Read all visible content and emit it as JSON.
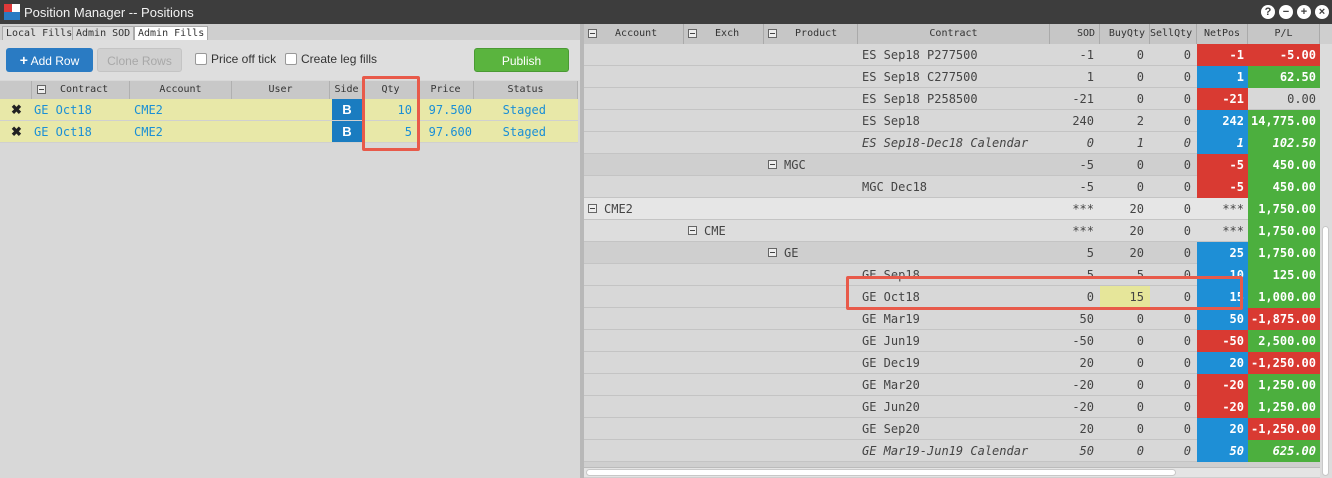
{
  "window": {
    "title": "Position Manager -- Positions",
    "controls": [
      "?",
      "−",
      "+",
      "×"
    ]
  },
  "left": {
    "tabs": [
      "Local Fills",
      "Admin SOD",
      "Admin Fills"
    ],
    "active_tab": "Admin Fills",
    "toolbar": {
      "add_row": "Add Row",
      "clone_rows": "Clone Rows",
      "price_off_tick": "Price off tick",
      "create_leg_fills": "Create leg fills",
      "publish": "Publish"
    },
    "columns": [
      "Contract",
      "Account",
      "User",
      "Side",
      "Qty",
      "Price",
      "Status"
    ],
    "rows": [
      {
        "contract": "GE Oct18",
        "account": "CME2",
        "user": "",
        "side": "B",
        "qty": "10",
        "price": "97.500",
        "status": "Staged"
      },
      {
        "contract": "GE Oct18",
        "account": "CME2",
        "user": "",
        "side": "B",
        "qty": "5",
        "price": "97.600",
        "status": "Staged"
      }
    ]
  },
  "right": {
    "columns": [
      "Account",
      "Exch",
      "Product",
      "Contract",
      "SOD",
      "BuyQty",
      "SellQty",
      "NetPos",
      "P/L"
    ],
    "rows": [
      {
        "label": "ES Sep18 P277500",
        "indent": "contract",
        "sod": "-1",
        "buy": "0",
        "sell": "0",
        "netpos": "-1",
        "np_color": "red",
        "pl": "-5.00",
        "pl_color": "red",
        "italic": false,
        "bg": "#d8d8d8"
      },
      {
        "label": "ES Sep18 C277500",
        "indent": "contract",
        "sod": "1",
        "buy": "0",
        "sell": "0",
        "netpos": "1",
        "np_color": "blue",
        "pl": "62.50",
        "pl_color": "green",
        "italic": false,
        "bg": "#d8d8d8"
      },
      {
        "label": "ES Sep18 P258500",
        "indent": "contract",
        "sod": "-21",
        "buy": "0",
        "sell": "0",
        "netpos": "-21",
        "np_color": "red",
        "pl": "0.00",
        "pl_color": "none",
        "italic": false,
        "bg": "#d8d8d8"
      },
      {
        "label": "ES Sep18",
        "indent": "contract",
        "sod": "240",
        "buy": "2",
        "sell": "0",
        "netpos": "242",
        "np_color": "blue",
        "pl": "14,775.00",
        "pl_color": "green",
        "italic": false,
        "bg": "#d8d8d8"
      },
      {
        "label": "ES Sep18-Dec18 Calendar",
        "indent": "contract",
        "sod": "0",
        "buy": "1",
        "sell": "0",
        "netpos": "1",
        "np_color": "blue",
        "pl": "102.50",
        "pl_color": "green",
        "italic": true,
        "bg": "#d8d8d8"
      },
      {
        "label": "MGC",
        "indent": "product",
        "sod": "-5",
        "buy": "0",
        "sell": "0",
        "netpos": "-5",
        "np_color": "red",
        "pl": "450.00",
        "pl_color": "green",
        "italic": false,
        "bg": "#cfcfcf"
      },
      {
        "label": "MGC Dec18",
        "indent": "contract",
        "sod": "-5",
        "buy": "0",
        "sell": "0",
        "netpos": "-5",
        "np_color": "red",
        "pl": "450.00",
        "pl_color": "green",
        "italic": false,
        "bg": "#d8d8d8"
      },
      {
        "label": "CME2",
        "indent": "account",
        "sod": "***",
        "buy": "20",
        "sell": "0",
        "netpos": "***",
        "np_color": "none",
        "pl": "1,750.00",
        "pl_color": "green",
        "italic": false,
        "bg": "#e6e6e6"
      },
      {
        "label": "CME",
        "indent": "exch",
        "sod": "***",
        "buy": "20",
        "sell": "0",
        "netpos": "***",
        "np_color": "none",
        "pl": "1,750.00",
        "pl_color": "green",
        "italic": false,
        "bg": "#dddddd"
      },
      {
        "label": "GE",
        "indent": "product",
        "sod": "5",
        "buy": "20",
        "sell": "0",
        "netpos": "25",
        "np_color": "blue",
        "pl": "1,750.00",
        "pl_color": "green",
        "italic": false,
        "bg": "#cfcfcf"
      },
      {
        "label": "GE Sep18",
        "indent": "contract",
        "sod": "5",
        "buy": "5",
        "sell": "0",
        "netpos": "10",
        "np_color": "blue",
        "pl": "125.00",
        "pl_color": "green",
        "italic": false,
        "bg": "#d8d8d8"
      },
      {
        "label": "GE Oct18",
        "indent": "contract",
        "sod": "0",
        "buy": "15",
        "sell": "0",
        "netpos": "15",
        "np_color": "blue",
        "pl": "1,000.00",
        "pl_color": "green",
        "italic": false,
        "bg": "#d8d8d8",
        "buy_highlight": true
      },
      {
        "label": "GE Mar19",
        "indent": "contract",
        "sod": "50",
        "buy": "0",
        "sell": "0",
        "netpos": "50",
        "np_color": "blue",
        "pl": "-1,875.00",
        "pl_color": "red",
        "italic": false,
        "bg": "#d8d8d8"
      },
      {
        "label": "GE Jun19",
        "indent": "contract",
        "sod": "-50",
        "buy": "0",
        "sell": "0",
        "netpos": "-50",
        "np_color": "red",
        "pl": "2,500.00",
        "pl_color": "green",
        "italic": false,
        "bg": "#d8d8d8"
      },
      {
        "label": "GE Dec19",
        "indent": "contract",
        "sod": "20",
        "buy": "0",
        "sell": "0",
        "netpos": "20",
        "np_color": "blue",
        "pl": "-1,250.00",
        "pl_color": "red",
        "italic": false,
        "bg": "#d8d8d8"
      },
      {
        "label": "GE Mar20",
        "indent": "contract",
        "sod": "-20",
        "buy": "0",
        "sell": "0",
        "netpos": "-20",
        "np_color": "red",
        "pl": "1,250.00",
        "pl_color": "green",
        "italic": false,
        "bg": "#d8d8d8"
      },
      {
        "label": "GE Jun20",
        "indent": "contract",
        "sod": "-20",
        "buy": "0",
        "sell": "0",
        "netpos": "-20",
        "np_color": "red",
        "pl": "1,250.00",
        "pl_color": "green",
        "italic": false,
        "bg": "#d8d8d8"
      },
      {
        "label": "GE Sep20",
        "indent": "contract",
        "sod": "20",
        "buy": "0",
        "sell": "0",
        "netpos": "20",
        "np_color": "blue",
        "pl": "-1,250.00",
        "pl_color": "red",
        "italic": false,
        "bg": "#d8d8d8"
      },
      {
        "label": "GE Mar19-Jun19 Calendar",
        "indent": "contract",
        "sod": "50",
        "buy": "0",
        "sell": "0",
        "netpos": "50",
        "np_color": "blue",
        "pl": "625.00",
        "pl_color": "green",
        "italic": true,
        "bg": "#d8d8d8"
      }
    ]
  },
  "colors": {
    "red": "#d93a32",
    "blue": "#1e8fd6",
    "green": "#4caf3e",
    "highlight": "#e85a4a",
    "staged_row": "#e8e8a8",
    "buy_highlight": "#e6e69a"
  }
}
